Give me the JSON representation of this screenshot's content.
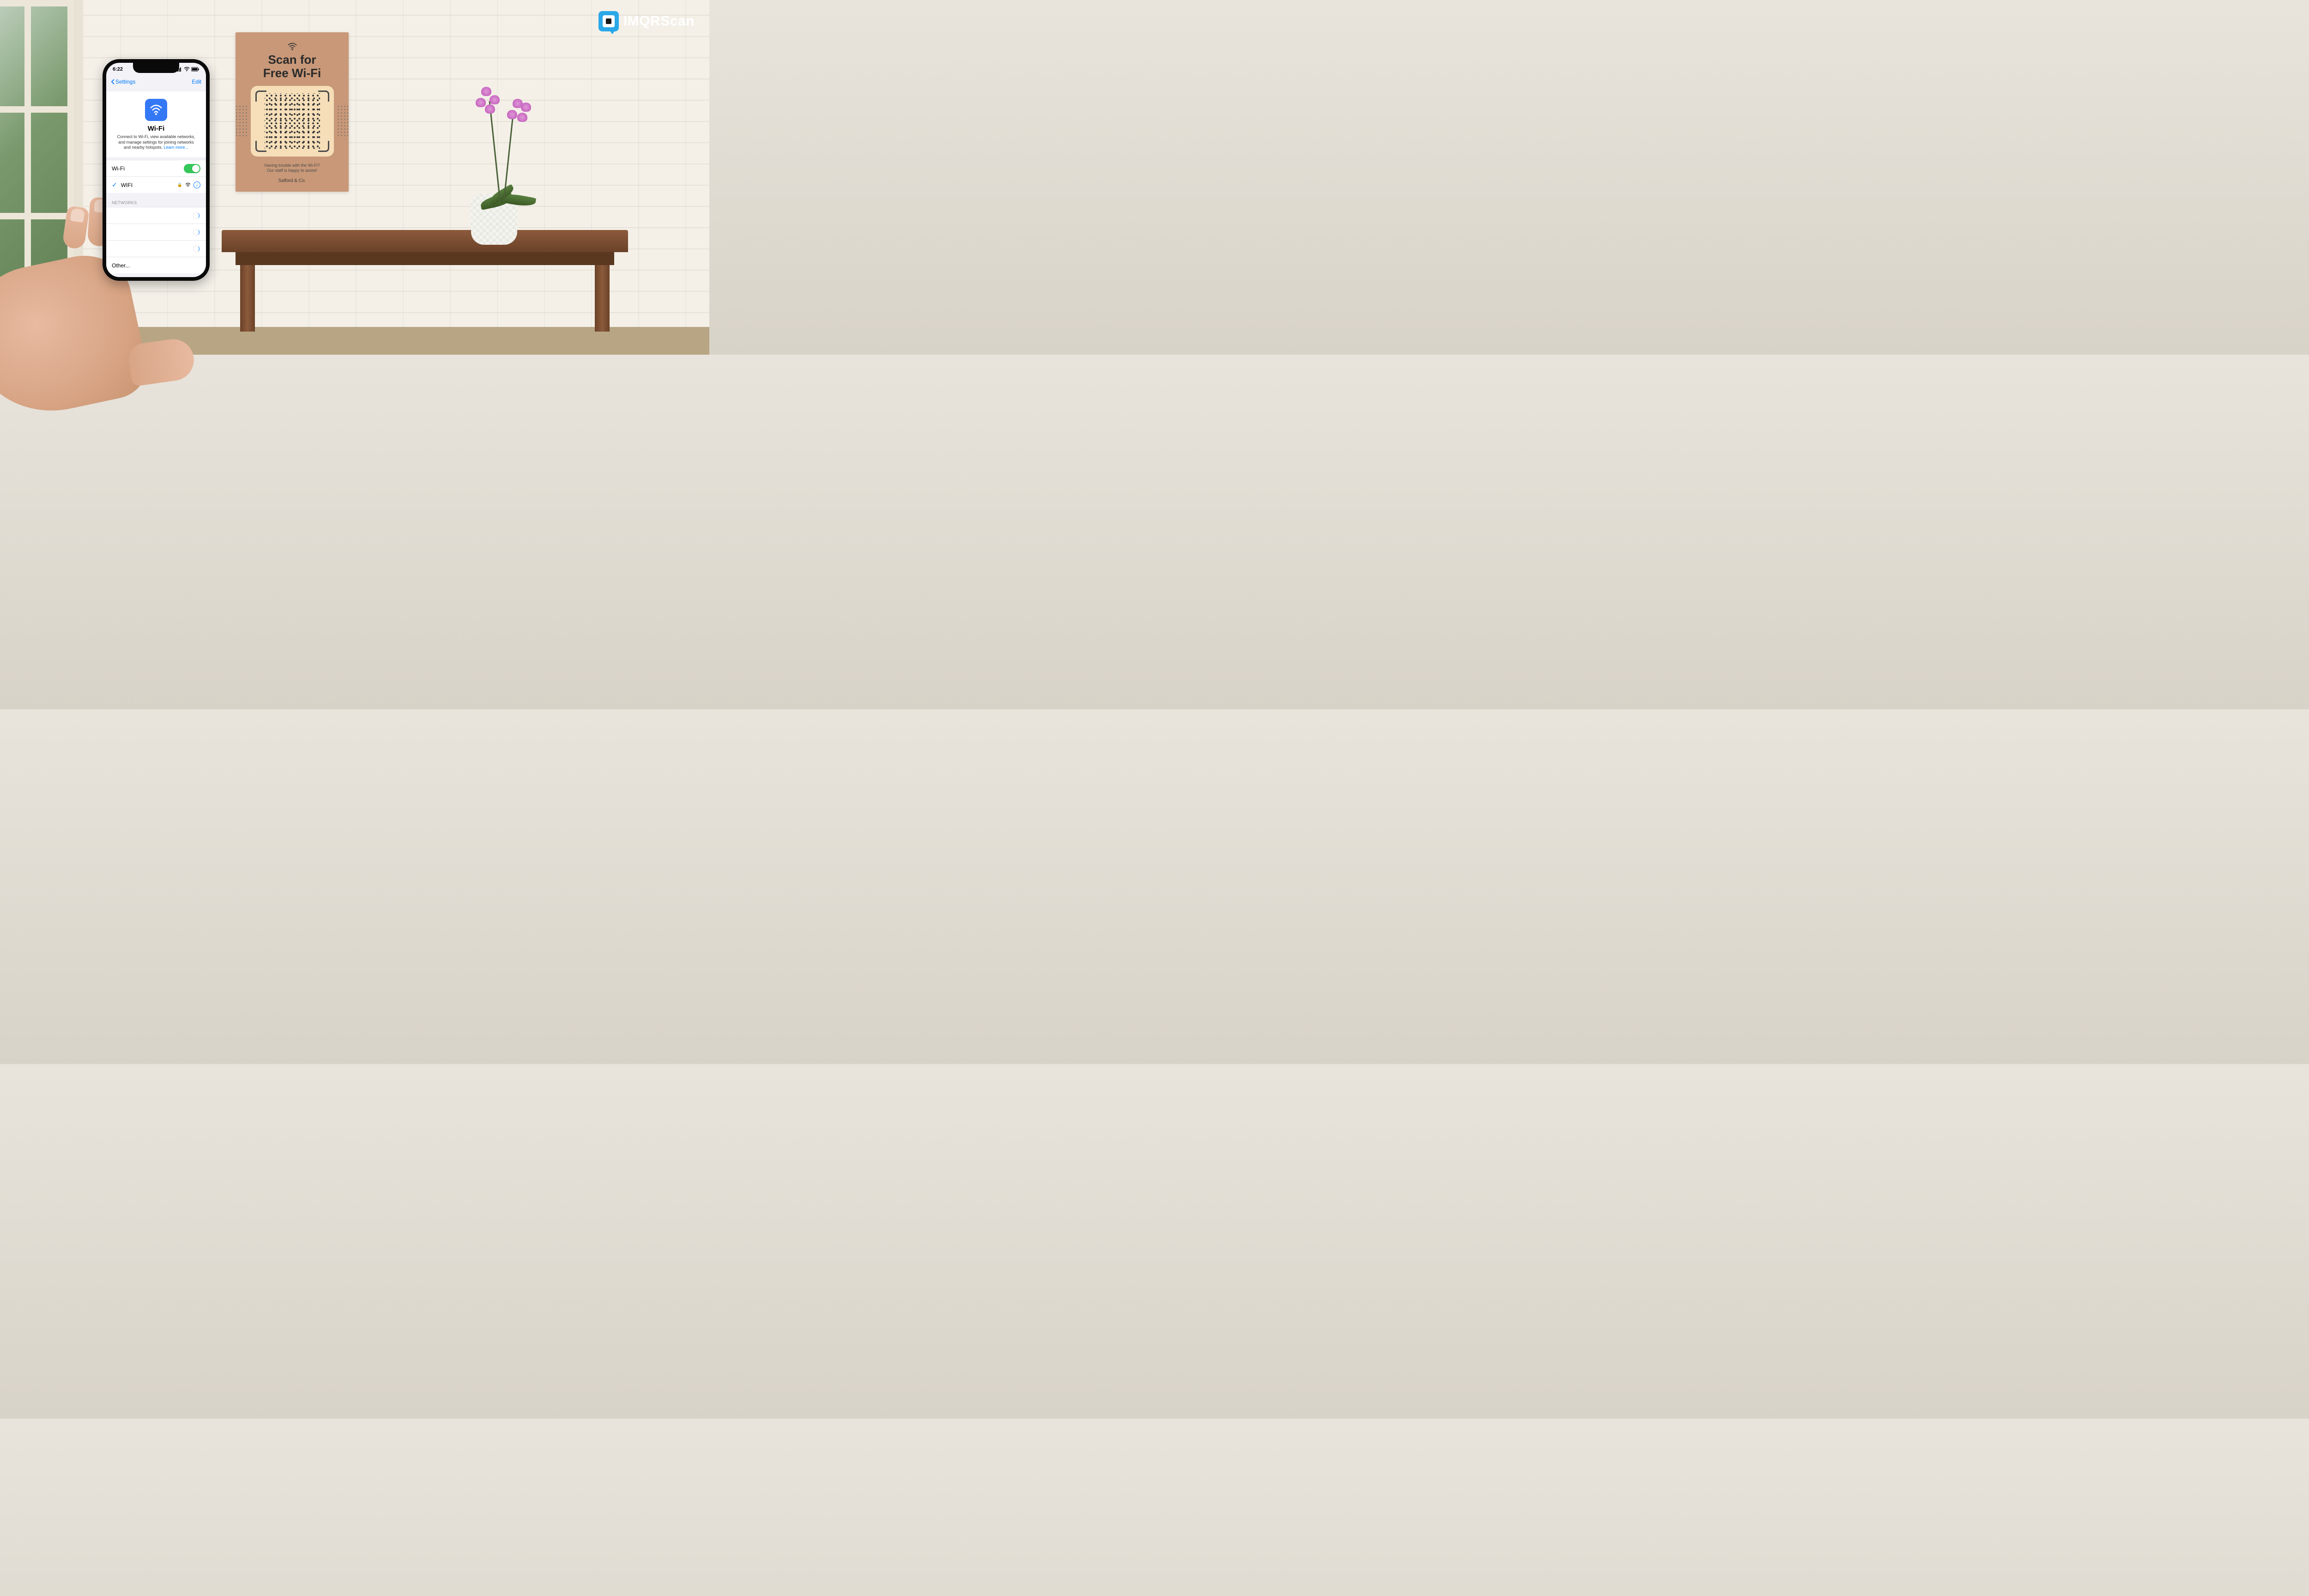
{
  "brand": {
    "name": "IMQRScan"
  },
  "poster": {
    "title_line1": "Scan for",
    "title_line2": "Free Wi-Fi",
    "subtext_line1": "Having trouble with the Wi-Fi?",
    "subtext_line2": "Our staff is happy to assist!",
    "company": "Salford & Co."
  },
  "phone": {
    "status": {
      "time": "6:22"
    },
    "nav": {
      "back": "Settings",
      "edit": "Edit"
    },
    "wifi_section": {
      "title": "Wi-Fi",
      "description": "Connect to Wi-Fi, view available networks, and manage settings for joining networks and nearby hotspots. ",
      "learn_more": "Learn more..."
    },
    "rows": {
      "wifi_toggle_label": "Wi-Fi",
      "connected_network": "WIFI"
    },
    "sections": {
      "networks": "NETWORKS"
    },
    "other": "Other..."
  }
}
